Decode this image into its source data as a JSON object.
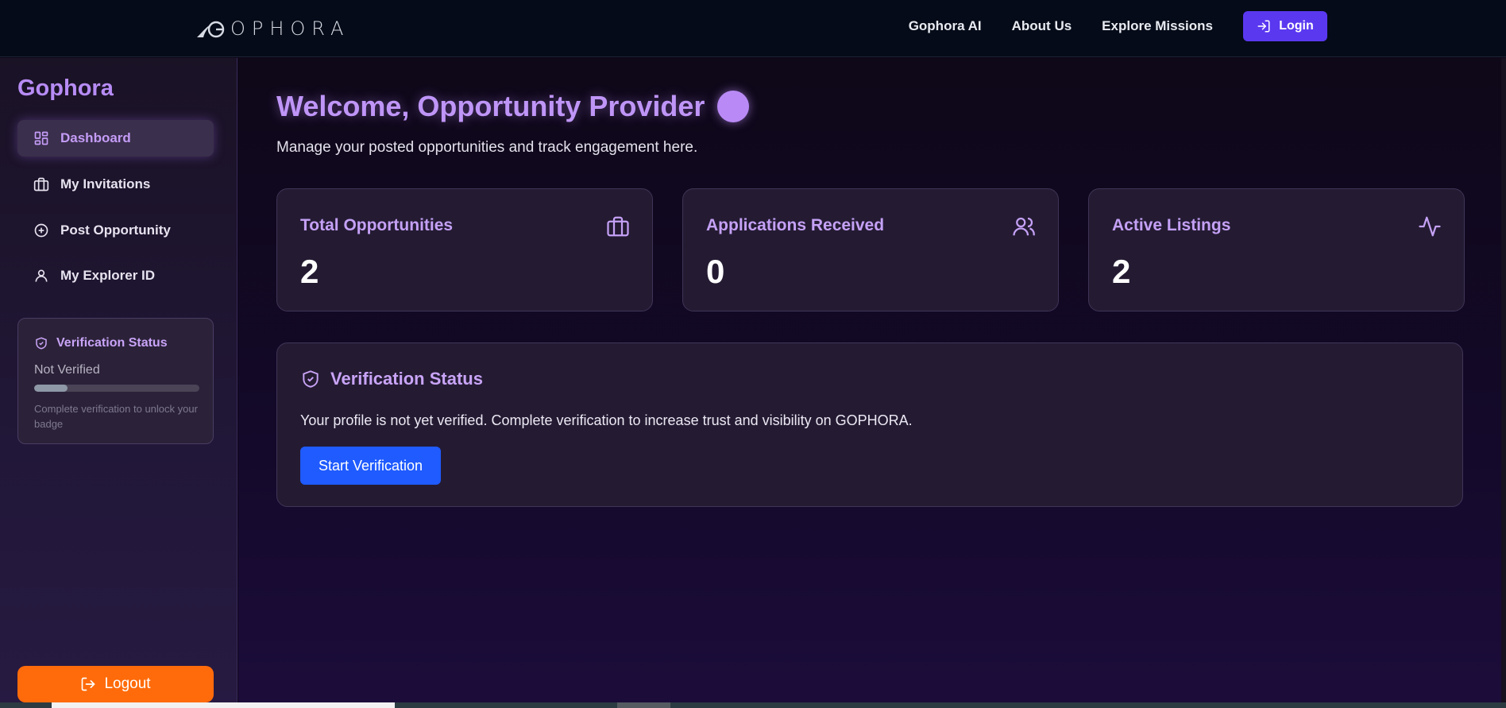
{
  "header": {
    "logo_text": "OPHORA",
    "nav": [
      "Gophora AI",
      "About Us",
      "Explore Missions"
    ],
    "login_label": "Login"
  },
  "sidebar": {
    "brand": "Gophora",
    "items": [
      {
        "label": "Dashboard",
        "icon": "dashboard-icon",
        "active": true
      },
      {
        "label": "My Invitations",
        "icon": "briefcase-icon",
        "active": false
      },
      {
        "label": "Post Opportunity",
        "icon": "plus-circle-icon",
        "active": false
      },
      {
        "label": "My Explorer ID",
        "icon": "user-icon",
        "active": false
      }
    ],
    "verification": {
      "title": "Verification Status",
      "state": "Not Verified",
      "progress": 0.2,
      "hint": "Complete verification to unlock your badge"
    },
    "logout_label": "Logout"
  },
  "main": {
    "welcome": "Welcome, Opportunity Provider",
    "subtitle": "Manage your posted opportunities and track engagement here.",
    "stats": [
      {
        "label": "Total Opportunities",
        "value": "2",
        "icon": "briefcase-icon"
      },
      {
        "label": "Applications Received",
        "value": "0",
        "icon": "users-icon"
      },
      {
        "label": "Active Listings",
        "value": "2",
        "icon": "activity-icon"
      }
    ],
    "verification_card": {
      "title": "Verification Status",
      "text": "Your profile is not yet verified. Complete verification to increase trust and visibility on GOPHORA.",
      "button": "Start Verification"
    }
  },
  "colors": {
    "accent": "#bf95f7",
    "login": "#5a38f0",
    "primary_button": "#1f5bff",
    "logout": "#ff6b0a"
  }
}
